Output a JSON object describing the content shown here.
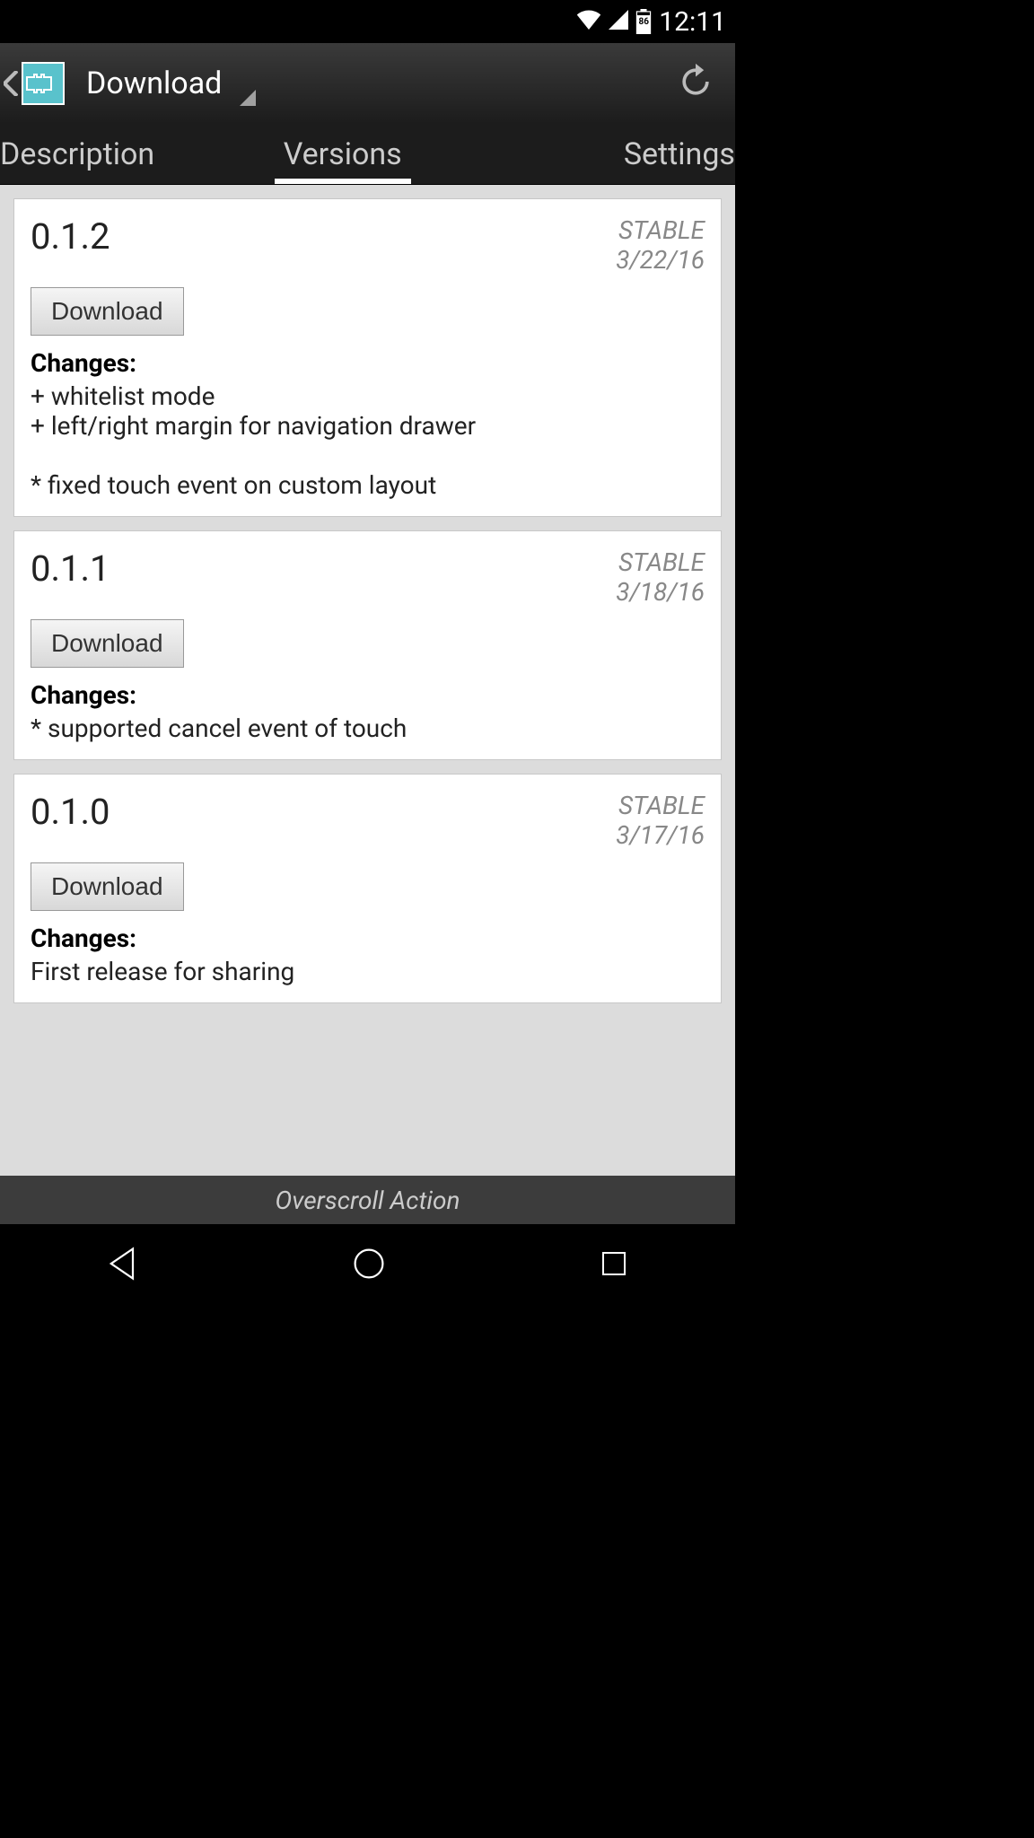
{
  "status": {
    "time": "12:11",
    "battery_pct": "86"
  },
  "appbar": {
    "title": "Download"
  },
  "tabs": {
    "left": "Description",
    "center": "Versions",
    "right": "Settings"
  },
  "versions": [
    {
      "number": "0.1.2",
      "stability": "STABLE",
      "date": "3/22/16",
      "download_label": "Download",
      "changes_heading": "Changes:",
      "changes_body": "+ whitelist mode\n+ left/right margin for navigation drawer\n\n* fixed touch event on custom layout"
    },
    {
      "number": "0.1.1",
      "stability": "STABLE",
      "date": "3/18/16",
      "download_label": "Download",
      "changes_heading": "Changes:",
      "changes_body": "* supported cancel event of touch"
    },
    {
      "number": "0.1.0",
      "stability": "STABLE",
      "date": "3/17/16",
      "download_label": "Download",
      "changes_heading": "Changes:",
      "changes_body": "First release for sharing"
    }
  ],
  "bottom_label": "Overscroll Action"
}
